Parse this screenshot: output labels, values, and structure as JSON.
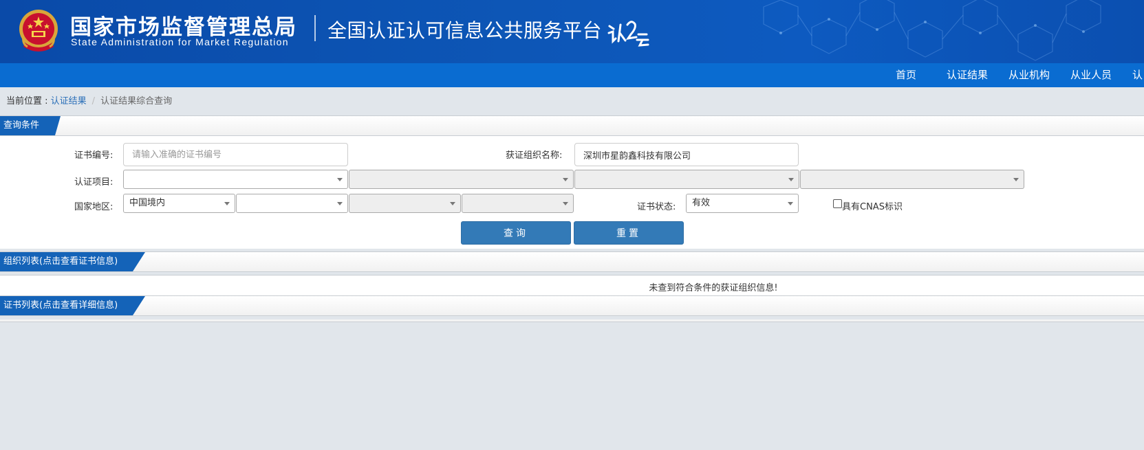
{
  "header": {
    "agency_cn": "国家市场监督管理总局",
    "agency_en": "State Administration  for  Market Regulation",
    "platform_title": "全国认证认可信息公共服务平台",
    "brand_logo_icon": "ren-yun-logo-icon",
    "emblem_icon": "national-emblem-icon"
  },
  "nav": {
    "items": [
      "首页",
      "认证结果",
      "从业机构",
      "从业人员",
      "认"
    ]
  },
  "breadcrumb": {
    "prefix": "当前位置 : ",
    "link": "认证结果",
    "separator": "/",
    "current": "认证结果综合查询"
  },
  "query_section": {
    "title": "查询条件"
  },
  "form": {
    "cert_no_label": "证书编号:",
    "cert_no_value": "",
    "cert_no_placeholder": "请输入准确的证书编号",
    "org_name_label": "获证组织名称:",
    "org_name_value": "深圳市星韵鑫科技有限公司",
    "cert_project_label": "认证项目:",
    "cert_project_selects": [
      "",
      "",
      "",
      ""
    ],
    "region_label": "国家地区:",
    "region_selects": [
      "中国境内",
      "",
      "",
      ""
    ],
    "cert_status_label": "证书状态:",
    "cert_status_value": "有效",
    "cnas_label": "具有CNAS标识",
    "cnas_checked": false
  },
  "buttons": {
    "search": "查询",
    "reset": "重置"
  },
  "org_section": {
    "title": "组织列表(点击查看证书信息)",
    "empty_message": "未查到符合条件的获证组织信息!"
  },
  "cert_section": {
    "title": "证书列表(点击查看详细信息)"
  },
  "colors": {
    "header_blue": "#0d56b6",
    "nav_blue": "#0a6cd1",
    "tab_blue": "#1463b8",
    "button_blue": "#337ab7",
    "page_bg": "#e1e6eb"
  }
}
